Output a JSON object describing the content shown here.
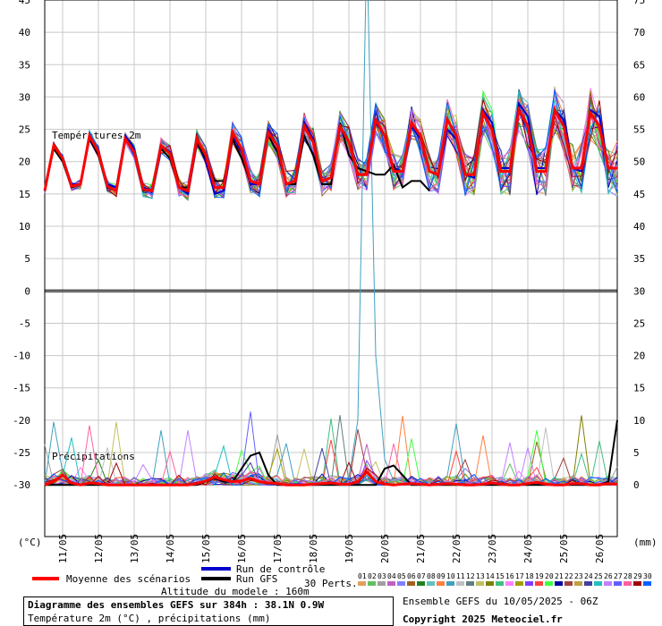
{
  "chart_data": {
    "type": "line",
    "dates": [
      "11/05",
      "12/05",
      "13/05",
      "14/05",
      "15/05",
      "16/05",
      "17/05",
      "18/05",
      "19/05",
      "20/05",
      "21/05",
      "22/05",
      "23/05",
      "24/05",
      "25/05",
      "26/05"
    ],
    "left_ticks": [
      45,
      40,
      35,
      30,
      25,
      20,
      15,
      10,
      5,
      0,
      -5,
      -10,
      -15,
      -20,
      -25,
      -30
    ],
    "right_ticks": [
      75,
      70,
      65,
      60,
      55,
      50,
      45,
      40,
      35,
      30,
      25,
      20,
      15,
      10,
      5,
      0
    ],
    "left_unit": "(°C)",
    "right_unit": "(mm)",
    "temp_panel_label": "Températures 2m",
    "precip_panel_label": "Précipitations",
    "ylim_left": [
      -38,
      45
    ],
    "ylim_right": [
      -8,
      75
    ],
    "temperature": {
      "x_step_hours": 6,
      "control": [
        15.5,
        22.5,
        20.5,
        16.5,
        16.5,
        24,
        21.5,
        16.5,
        16,
        24,
        22,
        16,
        15.5,
        22.5,
        21.5,
        16,
        15,
        23,
        20,
        15,
        15.5,
        24,
        21.5,
        16.5,
        16.5,
        25,
        22.5,
        16.5,
        17,
        26,
        23.5,
        17,
        17.5,
        25.5,
        23,
        18,
        18,
        26,
        24,
        19,
        18.5,
        25.5,
        23.5,
        18.5,
        18,
        25,
        23.5,
        18,
        17.5,
        28,
        26,
        19,
        19,
        29,
        27,
        19,
        19,
        28,
        26.5,
        19,
        18.5,
        28,
        27,
        19,
        19
      ],
      "mean": [
        15.5,
        22.5,
        20.5,
        16.2,
        16.5,
        24,
        21.5,
        16.2,
        15.5,
        23.5,
        21.5,
        15.7,
        15.5,
        22.5,
        21.2,
        16,
        15.5,
        23.5,
        21,
        16,
        16,
        24.5,
        22,
        17,
        16.5,
        24.5,
        22.5,
        16.5,
        17,
        25.5,
        23,
        17,
        17.5,
        25.5,
        23,
        18,
        18,
        26.5,
        24,
        18.5,
        18.5,
        26,
        24,
        18.5,
        18,
        26.5,
        24,
        18,
        18,
        27.5,
        25,
        18.5,
        18.5,
        28,
        25.5,
        18.5,
        18.5,
        28,
        25.5,
        19,
        19,
        27.5,
        25.5,
        19,
        19
      ],
      "gfs": [
        15.5,
        22,
        20,
        16,
        16.5,
        23.5,
        21,
        16,
        15.5,
        23.5,
        21.5,
        15.5,
        15.5,
        22,
        20.5,
        16,
        16,
        23,
        20.5,
        17,
        17,
        23.5,
        20.5,
        17,
        16.5,
        24,
        21.5,
        16.5,
        16.5,
        24,
        21,
        16.5,
        16.5,
        26,
        21,
        19,
        18.5,
        18,
        18,
        19.5,
        16,
        17,
        17,
        15.5
      ],
      "perturbations": [
        [
          15.5,
          23,
          21,
          16,
          16.5,
          24,
          22,
          16.5,
          16,
          25,
          22.5,
          16,
          15,
          23,
          21,
          16,
          14.5,
          24,
          21,
          16,
          16,
          25,
          22.5,
          17,
          16.5,
          25,
          23,
          17,
          17,
          26,
          23.5,
          17.5,
          17,
          25,
          23,
          18,
          18,
          27,
          25,
          19,
          19,
          27,
          25,
          19,
          18,
          27,
          24.5,
          18,
          18,
          28,
          25.5,
          19,
          19,
          28,
          26,
          19,
          19,
          28.5,
          26,
          19,
          19,
          28,
          26,
          19,
          19
        ]
      ]
    },
    "precipitation": {
      "x_step_hours": 6,
      "mean": [
        0,
        0.5,
        1.5,
        0.3,
        0,
        0.3,
        0.2,
        0,
        0,
        0,
        0,
        0,
        0,
        0,
        0,
        0,
        0,
        0.2,
        0.6,
        1.2,
        0.8,
        0.5,
        0.6,
        1,
        0.5,
        0.3,
        0.2,
        0,
        0,
        0,
        0.1,
        0.2,
        0.3,
        0.1,
        0.1,
        0.5,
        2,
        0.5,
        0.1,
        0,
        0.1,
        0.2,
        0.1,
        0,
        0.1,
        0.2,
        0.1,
        0,
        0,
        0.1,
        0.3,
        0.1,
        0,
        0,
        0.2,
        0.4,
        0.1,
        0,
        0,
        0.2,
        0.2,
        0,
        0,
        0.2,
        0.1
      ],
      "gfs": [
        0,
        0,
        0,
        0,
        0,
        0,
        0,
        0,
        0,
        0,
        0,
        0,
        0,
        0,
        0,
        0,
        0,
        0,
        0.5,
        1,
        0.5,
        0.5,
        2.5,
        4.5,
        5,
        1.5,
        0,
        0,
        0,
        0,
        0,
        0,
        0,
        0,
        0,
        0,
        0,
        0,
        2.5,
        3,
        1.5,
        0,
        0,
        0,
        0,
        0,
        0,
        0,
        0,
        0,
        0,
        0,
        0,
        0,
        0,
        0,
        0,
        0,
        0,
        0,
        0,
        0,
        0,
        0.5,
        10
      ],
      "notable_spike": {
        "member_index": 9,
        "value": 84
      }
    },
    "series_names": [
      "Moyenne des scénarios",
      "Run de contrôle",
      "Run GFS"
    ],
    "series_colors": {
      "mean": "#ff0000",
      "control": "#0000cc",
      "gfs": "#000000"
    },
    "perturbation_codes": [
      "01",
      "02",
      "03",
      "04",
      "05",
      "06",
      "07",
      "08",
      "09",
      "10",
      "11",
      "12",
      "13",
      "14",
      "15",
      "16",
      "17",
      "18",
      "19",
      "20",
      "21",
      "22",
      "23",
      "24",
      "25",
      "26",
      "27",
      "28",
      "29",
      "30"
    ],
    "perturbation_colors": [
      "#e0a060",
      "#60c060",
      "#a0a0a0",
      "#c060c0",
      "#8080ff",
      "#a06020",
      "#208020",
      "#60c0c0",
      "#ff8040",
      "#40a0c0",
      "#c0c0c0",
      "#608080",
      "#c0c060",
      "#808000",
      "#40c080",
      "#ff80ff",
      "#a0a000",
      "#8040ff",
      "#ff4040",
      "#40ff40",
      "#0000a0",
      "#a04040",
      "#c0a040",
      "#4040a0",
      "#20c0c0",
      "#c080ff",
      "#6060ff",
      "#ff60a0",
      "#a00000",
      "#0060ff"
    ],
    "perts_label": "30 Perts."
  },
  "footer": {
    "altitude": "Altitude du modele : 160m",
    "title": "Diagramme des ensembles GEFS sur 384h : 38.1N 0.9W",
    "subtitle": "Température 2m (°C) , précipitations (mm)",
    "ensemble_info": "Ensemble GEFS du 10/05/2025 - 06Z",
    "copyright": "Copyright 2025 Meteociel.fr"
  }
}
